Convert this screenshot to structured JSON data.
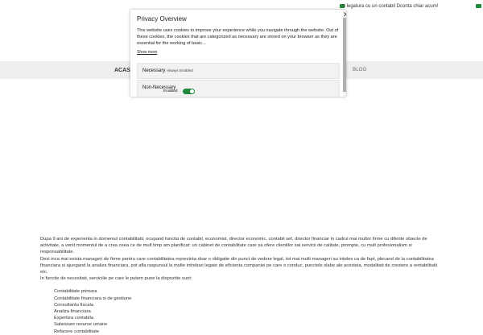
{
  "topbar": {
    "message": "ti legatura cu un contabil Dconta chiar acum!"
  },
  "nav": {
    "left": "ACASA",
    "right": "BLOG"
  },
  "privacy": {
    "title": "Privacy Overview",
    "close": "✕",
    "description": "This website uses cookies to improve your experience while you navigate through the website. Out of these cookies, the cookies that are categorized as necessary are stored on your browser as they are essential for the working of basic...",
    "show_more": "Show more",
    "necessary": {
      "title": "Necessary",
      "badge": "Always Enabled"
    },
    "non_necessary": {
      "title": "Non-Necessary",
      "state": "Enabled",
      "enabled": true
    }
  },
  "content": {
    "paragraph1": "Dupa 9 ani de experienta in domeniul contabilitatii, ocupand functia de contabil, economist, director economic, contabil sef, director financiar in cadrul mai multor firme cu diferite obiecte de activitate, a venit momentul de a crea ceea ce de mult timp am planificat: un cabinet de contabilitate care sa ofere clientilor sai servicii de calitate, prompte, cu mult profesionalism si responsabilitate.",
    "paragraph2": "Desi inca mai exista manageri de firme pentru care contabilitatea reprezinta doar o obligatie din punct de vedere legal, tot mai multi manageri au inteles ca de fapt, plecand de la contabilitatea financiara si ajungand la analiza financiara, pot afla raspunsul la multe intrebari legate de eficienta companiei pe care o conduc, punctele slabe ale acesteia, modalitati de crestere a rentabilitatii etc.",
    "paragraph3": "In functie de necesitati, serviciile pe care le putem pune la dispozitie sunt:",
    "services": [
      "Contabilitate primara",
      "Contabilitate financiara si de gestiune",
      "Consultanta fiscala",
      "Analiza financiara",
      "Expertiza contabila",
      "Salarizare resurse umane",
      "Refacere contabilitate"
    ]
  }
}
